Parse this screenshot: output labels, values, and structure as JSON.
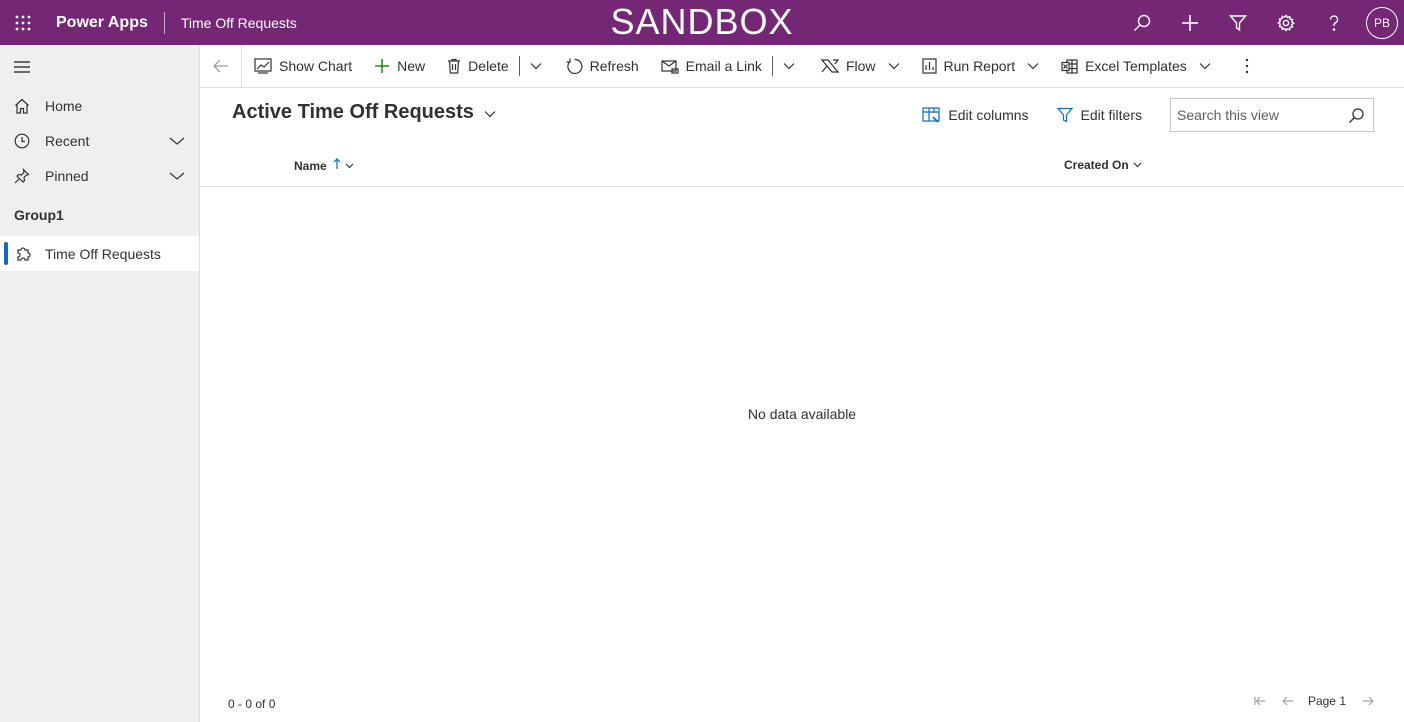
{
  "header": {
    "app_name": "Power Apps",
    "app_title": "Time Off Requests",
    "environment_banner": "SANDBOX",
    "user_initials": "PB",
    "background_color": "#742774",
    "icons": [
      "search-icon",
      "plus-icon",
      "filter-icon",
      "gear-icon",
      "help-icon"
    ]
  },
  "sidebar": {
    "items": [
      {
        "label": "Home",
        "icon": "home-icon"
      },
      {
        "label": "Recent",
        "icon": "clock-icon",
        "expandable": true
      },
      {
        "label": "Pinned",
        "icon": "pin-icon",
        "expandable": true
      }
    ],
    "group_label": "Group1",
    "group_items": [
      {
        "label": "Time Off Requests",
        "icon": "puzzle-icon",
        "active": true
      }
    ],
    "active_color": "#0f6cbd"
  },
  "commandbar": {
    "show_chart": "Show Chart",
    "new": "New",
    "delete": "Delete",
    "refresh": "Refresh",
    "email_link": "Email a Link",
    "flow": "Flow",
    "run_report": "Run Report",
    "excel_templates": "Excel Templates"
  },
  "view": {
    "title": "Active Time Off Requests",
    "edit_columns": "Edit columns",
    "edit_filters": "Edit filters",
    "search_placeholder": "Search this view",
    "search_value": ""
  },
  "grid": {
    "columns": [
      {
        "label": "Name",
        "sorted": "ascending"
      },
      {
        "label": "Created On"
      }
    ],
    "rows": [],
    "empty_message": "No data available"
  },
  "footer": {
    "record_count": "0 - 0 of 0",
    "page_label": "Page 1"
  }
}
